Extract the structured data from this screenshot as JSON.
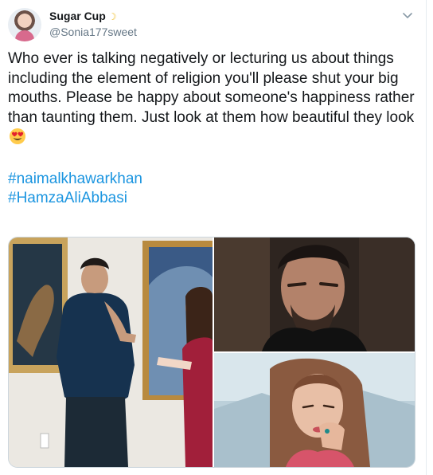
{
  "user": {
    "display_name": "Sugar Cup",
    "name_emoji": "crescent-moon-icon",
    "handle": "@Sonia177sweet"
  },
  "menu": {
    "icon": "chevron-down-icon"
  },
  "tweet": {
    "text": "Who ever is talking negatively or lecturing us about things including the element of religion you'll please shut your big mouths. Please be happy about someone's happiness rather than taunting them. Just look at them how beautiful they look",
    "trailing_emoji": "heart-eyes-emoji",
    "hashtags": [
      "#naimalkhawarkhan",
      "#HamzaAliAbbasi"
    ]
  },
  "media": {
    "photos": [
      "photo-couple-painting",
      "photo-man-portrait",
      "photo-woman-portrait"
    ]
  },
  "colors": {
    "text": "#14171a",
    "secondary": "#657786",
    "link": "#1b95e0",
    "border": "#ccd6dd"
  }
}
